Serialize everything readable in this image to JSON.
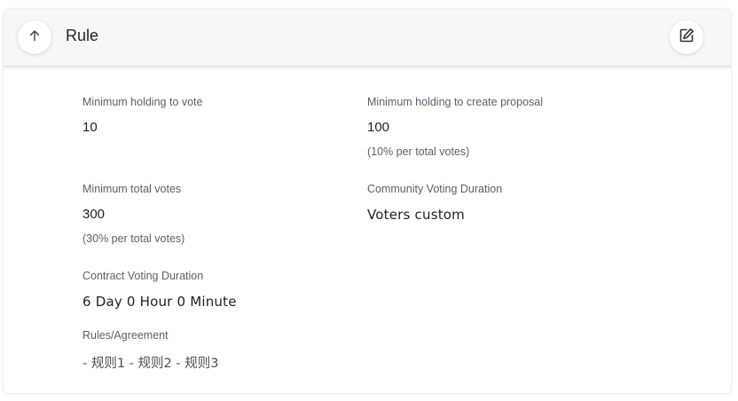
{
  "header": {
    "title": "Rule",
    "back_icon": "arrow-up-icon",
    "edit_icon": "edit-icon"
  },
  "rules": {
    "min_holding_vote": {
      "label": "Minimum holding to vote",
      "value": "10"
    },
    "min_holding_proposal": {
      "label": "Minimum holding to create proposal",
      "value": "100",
      "note": "(10% per total votes)"
    },
    "min_total_votes": {
      "label": "Minimum total votes",
      "value": "300",
      "note": "(30% per total votes)"
    },
    "community_voting_duration": {
      "label": "Community Voting Duration",
      "value": "Voters custom"
    },
    "contract_voting_duration": {
      "label": "Contract Voting Duration",
      "value": "6 Day 0 Hour 0 Minute"
    },
    "rules_agreement": {
      "label": "Rules/Agreement",
      "value": "- 规则1 - 规则2 - 规则3"
    }
  }
}
